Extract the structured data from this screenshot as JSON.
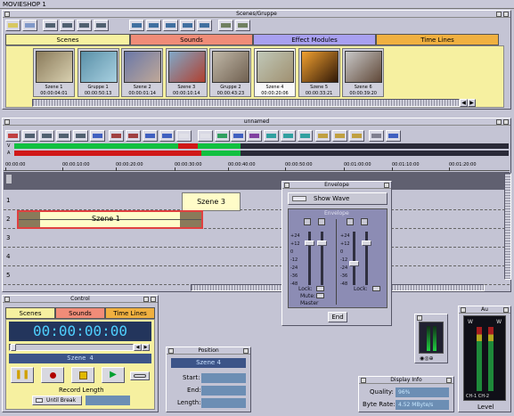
{
  "app_title": "MOVIESHOP 1",
  "scenes_window": {
    "title": "Scenes/Gruppe",
    "tabs": [
      {
        "label": "Scenes",
        "color": "#f6f0a0"
      },
      {
        "label": "Sounds",
        "color": "#f08c78"
      },
      {
        "label": "Effect Modules",
        "color": "#a8a0f0"
      },
      {
        "label": "Time Lines",
        "color": "#f0b040"
      }
    ],
    "thumbnails": [
      {
        "name": "Szene 1",
        "time": "00:00:04:01",
        "c1": "#8a7a5a",
        "c2": "#d8d0b0"
      },
      {
        "name": "Gruppe 1",
        "time": "00:00:50:13",
        "c1": "#5a90a8",
        "c2": "#a8d0e0"
      },
      {
        "name": "Szene 2",
        "time": "00:00:01:14",
        "c1": "#6a78a8",
        "c2": "#c0a898"
      },
      {
        "name": "Szene 3",
        "time": "00:00:10:14",
        "c1": "#80a8c8",
        "c2": "#b04030"
      },
      {
        "name": "Gruppe 2",
        "time": "00:00:43:23",
        "c1": "#c0b8a8",
        "c2": "#706050"
      },
      {
        "name": "Szene 4",
        "time": "00:00:20:06",
        "c1": "#c0c8b8",
        "c2": "#a09070"
      },
      {
        "name": "Szene 5",
        "time": "00:00:33:21",
        "c1": "#f0a030",
        "c2": "#301808"
      },
      {
        "name": "Szene 6",
        "time": "00:00:39:20",
        "c1": "#c8c8c8",
        "c2": "#604838"
      }
    ]
  },
  "timeline_window": {
    "title": "unnamed",
    "ruler": [
      "00:00:00",
      "00:00:10:00",
      "00:00:20:00",
      "00:00:30:00",
      "00:00:40:00",
      "00:00:50:00",
      "00:01:00:00",
      "00:01:10:00",
      "00:01:20:00"
    ],
    "track_numbers": [
      "1",
      "2",
      "3",
      "4",
      "5"
    ],
    "clip_szene3": "Szene 3",
    "clip_szene1": "Szene 1",
    "channel_labels": [
      "V",
      "A"
    ]
  },
  "envelope_window": {
    "title": "Envelope",
    "show_wave": "Show Wave",
    "section_label": "Envelope",
    "scale": [
      "+24",
      "+12",
      "0",
      "-12",
      "-24",
      "-36",
      "-48"
    ],
    "lock_label": "Lock:",
    "mute_label": "Mute:",
    "master_label": "Master",
    "end_button": "End"
  },
  "control_window": {
    "title": "Control",
    "tabs": [
      {
        "label": "Scenes",
        "color": "#f6f0a0"
      },
      {
        "label": "Sounds",
        "color": "#f08c78"
      },
      {
        "label": "Time Lines",
        "color": "#f0b040"
      }
    ],
    "timecode": "00:00:00:00",
    "scene_name": "Szene 4",
    "record_length_label": "Record Length",
    "until_break": "Until Break"
  },
  "position_window": {
    "title": "Position",
    "scene_name": "Szene 4",
    "start_label": "Start:",
    "end_label": "End:",
    "length_label": "Length:"
  },
  "display_info_window": {
    "title": "Display Info",
    "quality_label": "Quality:",
    "quality_value": "96%",
    "byte_rate_label": "Byte Rate:",
    "byte_rate_value": "4.52 MByte/s"
  },
  "level_window": {
    "title": "Au",
    "label": "Level",
    "ch_left": "W",
    "ch_right": "W",
    "ch_bottom": "CH-1 CH-2"
  }
}
